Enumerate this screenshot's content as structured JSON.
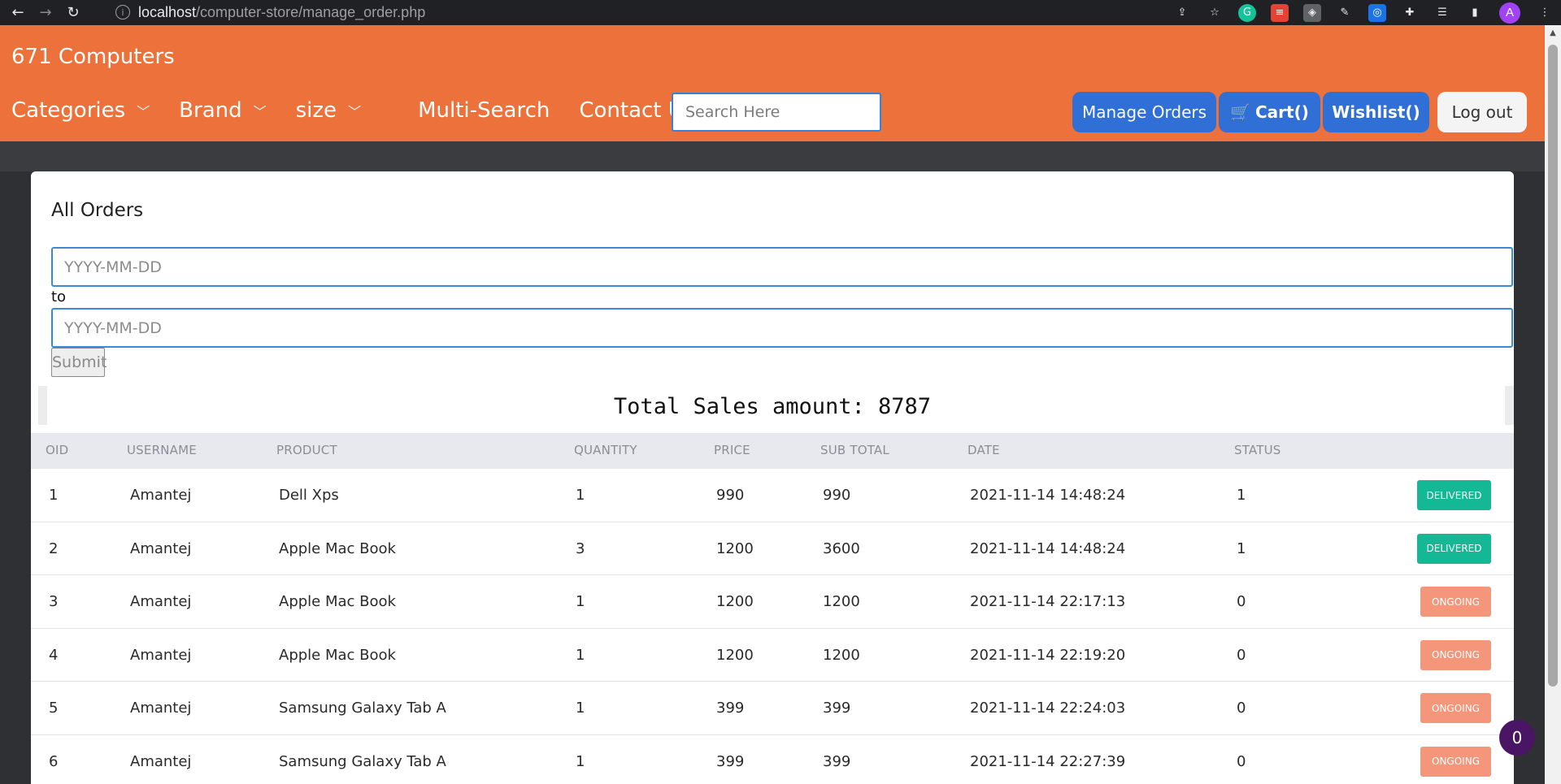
{
  "browser": {
    "url_host": "localhost",
    "url_path": "/computer-store/manage_order.php",
    "back_icon": "back-arrow-icon",
    "forward_icon": "forward-arrow-icon",
    "reload_icon": "reload-icon",
    "profile_initial": "A"
  },
  "site": {
    "brand": "671 Computers",
    "accent_color": "#ec713a",
    "menu": [
      "Categories",
      "Brand",
      "size",
      "Multi-Search",
      "Contact Us"
    ],
    "search_placeholder": "Search Here",
    "buttons": {
      "manage_orders": "Manage Orders",
      "cart": "Cart()",
      "wishlist": "Wishlist()",
      "logout": "Log out"
    }
  },
  "orders_panel": {
    "title": "All Orders",
    "from_placeholder": "YYYY-MM-DD",
    "to_label": "to",
    "to_placeholder": "YYYY-MM-DD",
    "submit_label": "Submit",
    "total_sales": "Total Sales amount: 8787"
  },
  "table": {
    "columns": [
      "OID",
      "USERNAME",
      "PRODUCT",
      "QUANTITY",
      "PRICE",
      "SUB TOTAL",
      "DATE",
      "STATUS"
    ],
    "rows": [
      {
        "oid": "1",
        "username": "Amantej",
        "product": "Dell Xps",
        "quantity": "1",
        "price": "990",
        "subtotal": "990",
        "date": "2021-11-14 14:48:24",
        "status": "1",
        "badge": "DELIVERED"
      },
      {
        "oid": "2",
        "username": "Amantej",
        "product": "Apple Mac Book",
        "quantity": "3",
        "price": "1200",
        "subtotal": "3600",
        "date": "2021-11-14 14:48:24",
        "status": "1",
        "badge": "DELIVERED"
      },
      {
        "oid": "3",
        "username": "Amantej",
        "product": "Apple Mac Book",
        "quantity": "1",
        "price": "1200",
        "subtotal": "1200",
        "date": "2021-11-14 22:17:13",
        "status": "0",
        "badge": "ONGOING"
      },
      {
        "oid": "4",
        "username": "Amantej",
        "product": "Apple Mac Book",
        "quantity": "1",
        "price": "1200",
        "subtotal": "1200",
        "date": "2021-11-14 22:19:20",
        "status": "0",
        "badge": "ONGOING"
      },
      {
        "oid": "5",
        "username": "Amantej",
        "product": "Samsung Galaxy Tab A",
        "quantity": "1",
        "price": "399",
        "subtotal": "399",
        "date": "2021-11-14 22:24:03",
        "status": "0",
        "badge": "ONGOING"
      },
      {
        "oid": "6",
        "username": "Amantej",
        "product": "Samsung Galaxy Tab A",
        "quantity": "1",
        "price": "399",
        "subtotal": "399",
        "date": "2021-11-14 22:27:39",
        "status": "0",
        "badge": "ONGOING"
      }
    ]
  },
  "floating_counter": "0"
}
